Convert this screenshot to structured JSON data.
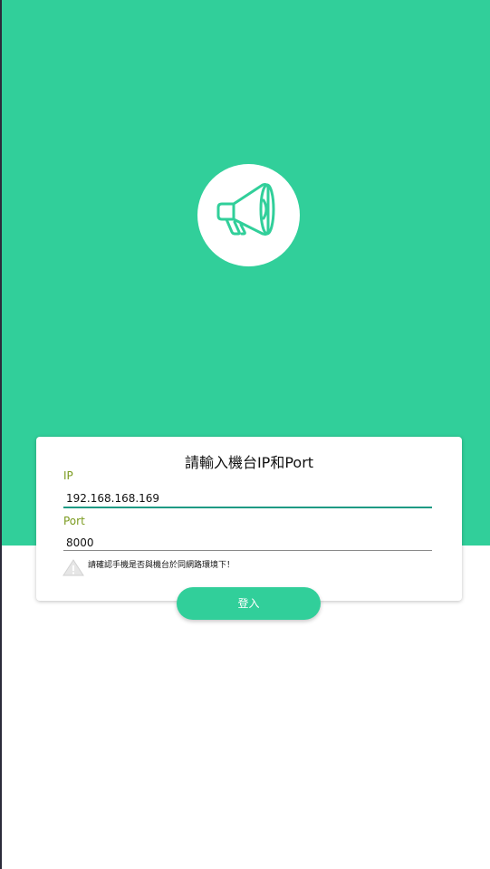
{
  "theme": {
    "primary_color": "#31cf9a",
    "label_color": "#7a9a1e",
    "active_underline_color": "#1f9a84"
  },
  "hero": {
    "icon": "megaphone-icon"
  },
  "form": {
    "title": "請輸入機台IP和Port",
    "ip": {
      "label": "IP",
      "value": "192.168.168.169"
    },
    "port": {
      "label": "Port",
      "value": "8000"
    },
    "warning": {
      "icon": "warning-triangle-icon",
      "text": "請確認手機是否與機台於同網路環境下！"
    }
  },
  "login_button": {
    "label": "登入"
  }
}
